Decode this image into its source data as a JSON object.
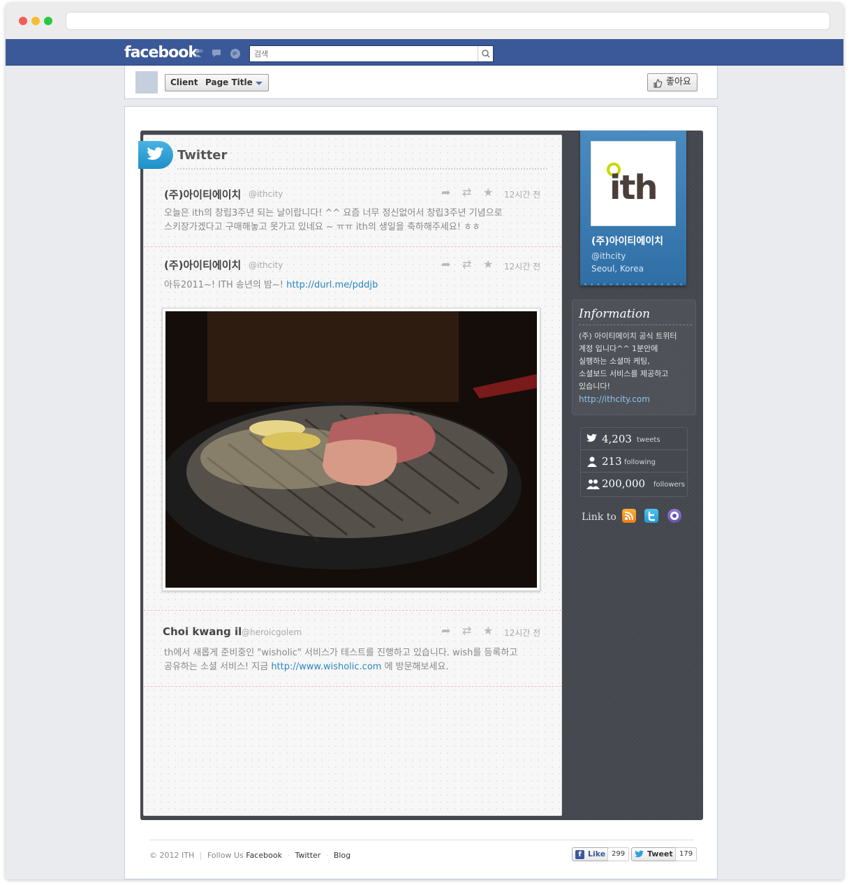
{
  "browser": {
    "url": ""
  },
  "fb": {
    "logo": "facebook",
    "search_placeholder": "검색",
    "icons": [
      "friends-icon",
      "messages-icon",
      "notifications-icon",
      "search-icon"
    ],
    "brand_color": "#3b5998"
  },
  "page_header": {
    "client_label": "Client",
    "page_title_label": "Page Title",
    "like_label": "좋아요"
  },
  "feed": {
    "title": "Twitter",
    "tweets": [
      {
        "name": "(주)아이티에이치",
        "handle": "@ithcity",
        "time": "12시간 전",
        "text_line1": "오늘은 ith의 창립3주년 되는 날이랍니다! ^^ 요즘 너무 정신없어서 창립3주년 기념으로",
        "text_line2": "스키장가겠다고 구매해놓고 못가고 있네요 ~ ㅠㅠ ith의 생일을 축하해주세요! ㅎㅎ"
      },
      {
        "name": "(주)아이티에이치",
        "handle": "@ithcity",
        "time": "12시간 전",
        "text": "아듀2011~! ITH 송년의 밤~! ",
        "link": "http://durl.me/pddjb"
      },
      {
        "name": "Choi kwang il",
        "handle": "@heroicgolem",
        "time": "12시간 전",
        "text_line1": "th에서 새롭게 준비중인 \"wisholic\" 서비스가 테스트를 진행하고 있습니다. wish를 등록하고",
        "text_line2_pre": "공유하는 소셜 서비스! 지금 ",
        "link": "http://www.wisholic.com",
        "text_line2_post": " 에 방문해보세요."
      }
    ]
  },
  "profile": {
    "logo_text": "ith",
    "name": "(주)아이티에이치",
    "handle": "@ithcity",
    "location": "Seoul, Korea"
  },
  "information": {
    "title": "Information",
    "lines": [
      "(주) 아이티에이치 공식 트위터",
      "계정 입니다^^ 1분안에",
      "실행하는 소셜마 케팅,",
      "소셜보드 서비스를 제공하고",
      "있습니다!"
    ],
    "link": "http://ithcity.com"
  },
  "stats": [
    {
      "value": "4,203",
      "label": "tweets",
      "icon": "bird-icon"
    },
    {
      "value": "213",
      "label": "following",
      "icon": "person-icon"
    },
    {
      "value": "200,000",
      "label": "followers",
      "icon": "people-icon"
    }
  ],
  "link_to": {
    "label": "Link to",
    "icons": [
      "rss-icon",
      "twitter-icon",
      "blog-icon"
    ]
  },
  "footer": {
    "copyright": "© 2012 ITH",
    "follow_label": "Follow Us",
    "links": [
      "Facebook",
      "Twitter",
      "Blog"
    ],
    "like_btn": "Like",
    "like_count": "299",
    "tweet_btn": "Tweet",
    "tweet_count": "179"
  }
}
